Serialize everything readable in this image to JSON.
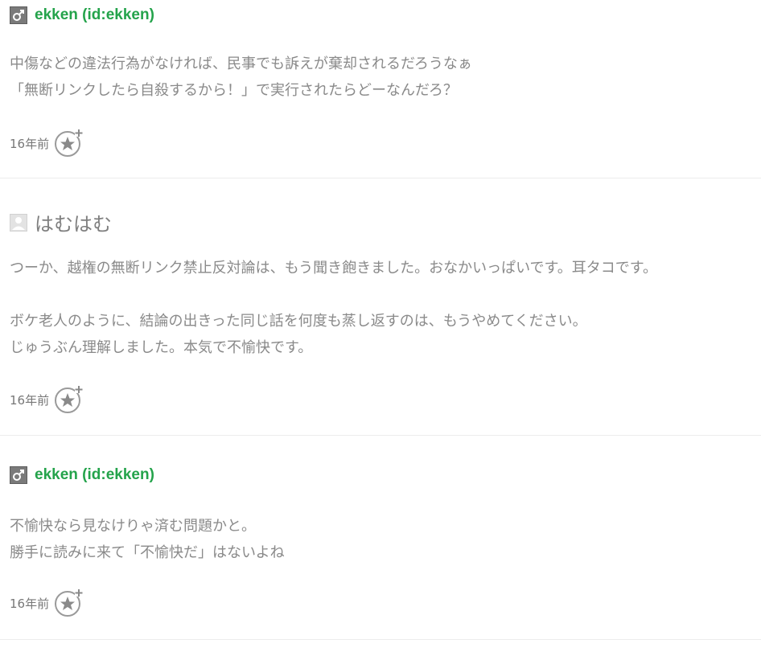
{
  "comments": [
    {
      "author": "ekken (id:ekken)",
      "avatar_icon": "male-symbol-icon",
      "lines": [
        "中傷などの違法行為がなければ、民事でも訴えが棄却されるだろうなぁ",
        "「無断リンクしたら自殺するから！」で実行されたらどーなんだろ？"
      ],
      "time": "16年前"
    },
    {
      "author": "はむはむ",
      "avatar_icon": "guest-user-icon",
      "lines": [
        "つーか、越権の無断リンク禁止反対論は、もう聞き飽きました。おなかいっぱいです。耳タコです。",
        "",
        "ボケ老人のように、結論の出きった同じ話を何度も蒸し返すのは、もうやめてください。",
        "じゅうぶん理解しました。本気で不愉快です。"
      ],
      "time": "16年前"
    },
    {
      "author": "ekken (id:ekken)",
      "avatar_icon": "male-symbol-icon",
      "lines": [
        "不愉快なら見なけりゃ済む問題かと。",
        "勝手に読みに来て「不愉快だ」はないよね"
      ],
      "time": "16年前"
    }
  ],
  "colors": {
    "author_link": "#24a34b",
    "body_text": "#8a8a8a",
    "divider": "#ececec"
  },
  "icons": {
    "star_add": "add-star-icon"
  }
}
